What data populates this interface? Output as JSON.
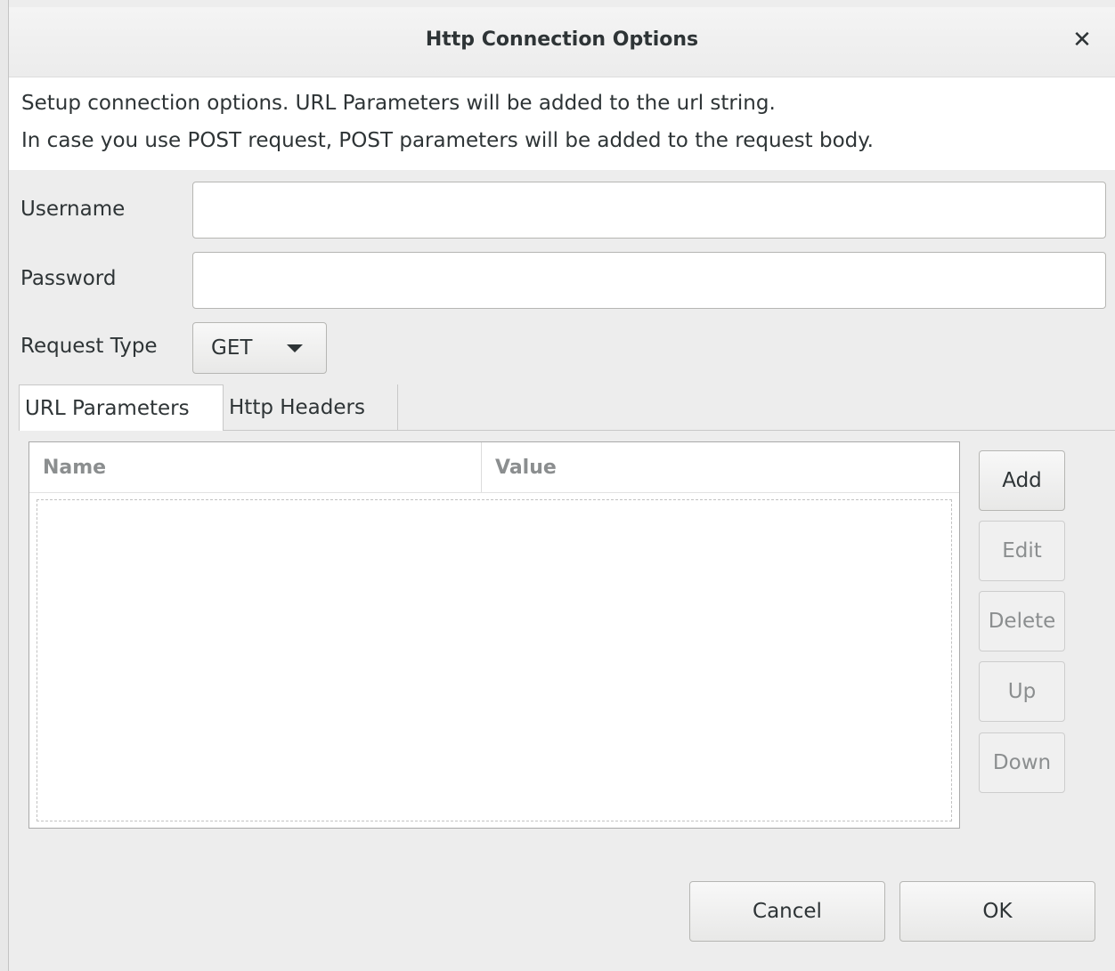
{
  "dialog": {
    "title": "Http Connection Options",
    "close_icon": "close-icon"
  },
  "info": {
    "line1": "Setup connection options. URL Parameters will be added to the url string.",
    "line2": "In case you use POST request, POST parameters will be added to the request body."
  },
  "form": {
    "username_label": "Username",
    "username_value": "",
    "password_label": "Password",
    "password_value": "",
    "request_type_label": "Request Type",
    "request_type_value": "GET"
  },
  "tabs": [
    {
      "label": "URL Parameters",
      "active": true
    },
    {
      "label": "Http Headers",
      "active": false
    }
  ],
  "table": {
    "columns": [
      "Name",
      "Value"
    ],
    "rows": []
  },
  "side_buttons": {
    "add": "Add",
    "edit": "Edit",
    "delete": "Delete",
    "up": "Up",
    "down": "Down"
  },
  "footer": {
    "cancel": "Cancel",
    "ok": "OK"
  }
}
